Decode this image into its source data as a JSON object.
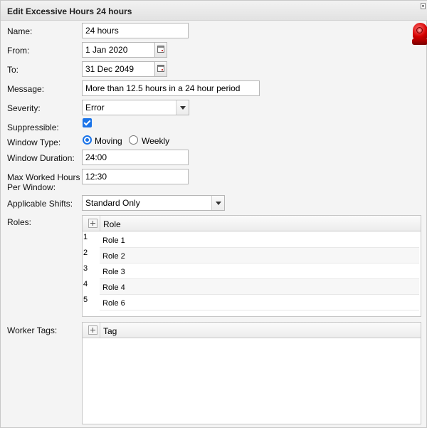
{
  "window": {
    "title": "Edit Excessive Hours 24 hours"
  },
  "form": {
    "name_label": "Name:",
    "name_value": "24 hours",
    "from_label": "From:",
    "from_value": "1 Jan 2020",
    "to_label": "To:",
    "to_value": "31 Dec 2049",
    "message_label": "Message:",
    "message_value": "More than 12.5 hours in a 24 hour period",
    "severity_label": "Severity:",
    "severity_value": "Error",
    "suppressible_label": "Suppressible:",
    "suppressible_checked": true,
    "window_type_label": "Window Type:",
    "window_type_options": [
      "Moving",
      "Weekly"
    ],
    "window_type_selected": "Moving",
    "window_duration_label": "Window Duration:",
    "window_duration_value": "24:00",
    "max_hours_label_line1": "Max Worked Hours",
    "max_hours_label_line2": "Per Window:",
    "max_hours_value": "12:30",
    "applicable_shifts_label": "Applicable Shifts:",
    "applicable_shifts_value": "Standard Only",
    "roles_label": "Roles:",
    "worker_tags_label": "Worker Tags:"
  },
  "roles_grid": {
    "column": "Role",
    "rows": [
      {
        "num": "1",
        "role": "Role 1"
      },
      {
        "num": "2",
        "role": "Role 2"
      },
      {
        "num": "3",
        "role": "Role 3"
      },
      {
        "num": "4",
        "role": "Role 4"
      },
      {
        "num": "5",
        "role": "Role 6"
      }
    ]
  },
  "tags_grid": {
    "column": "Tag",
    "rows": []
  },
  "colors": {
    "accent": "#1a73e8",
    "alarm": "#d40000"
  },
  "icons": [
    "calendar-icon",
    "chevron-down-icon",
    "add-icon",
    "alarm-icon",
    "window-menu-icon"
  ]
}
